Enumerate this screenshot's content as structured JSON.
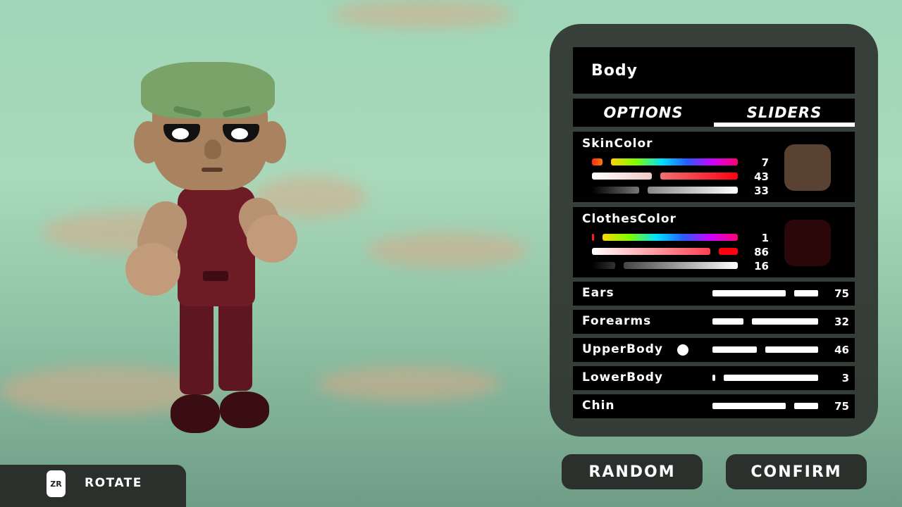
{
  "panel": {
    "title": "Body",
    "tabs": [
      {
        "label": "OPTIONS",
        "active": false
      },
      {
        "label": "SLIDERS",
        "active": true
      }
    ],
    "color_groups": [
      {
        "label": "SkinColor",
        "values": [
          "7",
          "43",
          "33"
        ],
        "levels": [
          0.07,
          0.43,
          0.33
        ],
        "swatch": "#5a4232"
      },
      {
        "label": "ClothesColor",
        "values": [
          "1",
          "86",
          "16"
        ],
        "levels": [
          0.01,
          0.86,
          0.16
        ],
        "swatch": "#2c0709"
      }
    ],
    "sliders": [
      {
        "label": "Ears",
        "value": "75",
        "level": 0.75
      },
      {
        "label": "Forearms",
        "value": "32",
        "level": 0.32
      },
      {
        "label": "UpperBody",
        "value": "46",
        "level": 0.46
      },
      {
        "label": "LowerBody",
        "value": "3",
        "level": 0.03
      },
      {
        "label": "Chin",
        "value": "75",
        "level": 0.75
      }
    ]
  },
  "buttons": {
    "random": "RANDOM",
    "confirm": "CONFIRM"
  },
  "hint": {
    "button_glyph": "ZR",
    "action": "ROTATE"
  },
  "colors": {
    "panel_bg": "#2c322e",
    "skin": "#c7a07f",
    "hair": "#7aa36a",
    "clothes": "#6b1a24"
  }
}
